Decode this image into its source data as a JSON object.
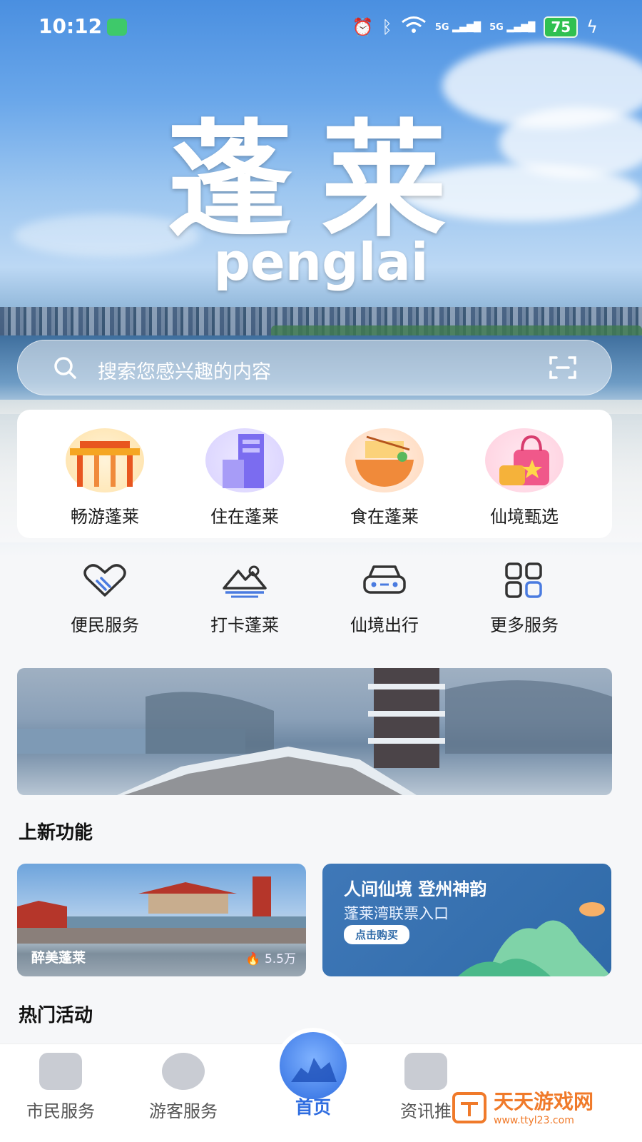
{
  "status_bar": {
    "time": "10:12",
    "signal1": "5G",
    "signal2": "5G",
    "battery": "75"
  },
  "hero": {
    "title_cn": "蓬莱",
    "title_en": "penglai"
  },
  "search": {
    "placeholder": "搜索您感兴趣的内容"
  },
  "top_services": [
    {
      "label": "畅游蓬莱",
      "icon": "archway-icon",
      "color": "#f5a623"
    },
    {
      "label": "住在蓬莱",
      "icon": "building-icon",
      "color": "#7b6cf0"
    },
    {
      "label": "食在蓬莱",
      "icon": "noodle-bowl-icon",
      "color": "#f08a3a"
    },
    {
      "label": "仙境甄选",
      "icon": "shopping-bag-icon",
      "color": "#f0588a"
    }
  ],
  "quick_services": [
    {
      "label": "便民服务",
      "icon": "handshake-heart-icon"
    },
    {
      "label": "打卡蓬莱",
      "icon": "mountain-icon"
    },
    {
      "label": "仙境出行",
      "icon": "car-icon"
    },
    {
      "label": "更多服务",
      "icon": "grid-icon"
    }
  ],
  "sections": {
    "new_features": "上新功能",
    "hot_activities": "热门活动"
  },
  "new_features": {
    "card1": {
      "caption": "醉美蓬莱",
      "views": "5.5万"
    },
    "card2": {
      "line1": "人间仙境 登州神韵",
      "line2": "蓬莱湾联票入口",
      "button": "点击购买"
    }
  },
  "tabbar": [
    {
      "label": "市民服务"
    },
    {
      "label": "游客服务"
    },
    {
      "label": "首页"
    },
    {
      "label": "资讯推"
    }
  ],
  "watermark": {
    "title": "天天游戏网",
    "url": "www.ttyl23.com"
  }
}
